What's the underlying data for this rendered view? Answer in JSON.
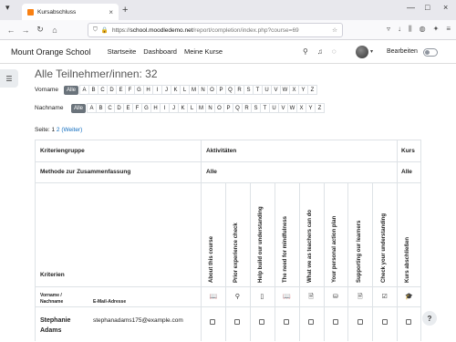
{
  "browser": {
    "tab_title": "Kursabschluss",
    "url_protocol": "https://",
    "url_host": "school.moodledemo.net",
    "url_rest": "/report/completion/index.php?course=69"
  },
  "header": {
    "brand": "Mount Orange School",
    "nav": [
      "Startseite",
      "Dashboard",
      "Meine Kurse"
    ],
    "edit_label": "Bearbeiten"
  },
  "page": {
    "title": "Alle Teilnehmer/innen: 32",
    "firstname_label": "Vorname",
    "lastname_label": "Nachname",
    "all_label": "Alle",
    "letters": [
      "A",
      "B",
      "C",
      "D",
      "E",
      "F",
      "G",
      "H",
      "I",
      "J",
      "K",
      "L",
      "M",
      "N",
      "O",
      "P",
      "Q",
      "R",
      "S",
      "T",
      "U",
      "V",
      "W",
      "X",
      "Y",
      "Z"
    ],
    "pager_label": "Seite:",
    "pager_current": "1",
    "pager_next_num": "2",
    "pager_next": "(Weiter)"
  },
  "table": {
    "row_criteria_group": "Kriteriengruppe",
    "activities_header": "Aktivitäten",
    "course_header": "Kurs",
    "row_method": "Methode zur Zusammenfassung",
    "activities_method": "Alle",
    "course_method": "Alle",
    "criteria_label": "Kriterien",
    "firstname_sub": "Vorname /",
    "lastname_sub": "Nachname",
    "email_sub": "E-Mail-Adresse",
    "activities": [
      {
        "name": "About this course",
        "icon": "book-icon",
        "glyph": "📖"
      },
      {
        "name": "Prior experience check",
        "icon": "choice-icon",
        "glyph": "⚲"
      },
      {
        "name": "Help build our understanding",
        "icon": "glossary-icon",
        "glyph": "▯"
      },
      {
        "name": "The need for mindfulness",
        "icon": "book-icon",
        "glyph": "📖"
      },
      {
        "name": "What we as teachers can do",
        "icon": "page-icon",
        "glyph": "🗎"
      },
      {
        "name": "Your personal action plan",
        "icon": "database-icon",
        "glyph": "⛁"
      },
      {
        "name": "Supporting our learners",
        "icon": "page-icon",
        "glyph": "🗎"
      },
      {
        "name": "Check your understanding",
        "icon": "quiz-icon",
        "glyph": "☑"
      }
    ],
    "course_completion_label": "Kurs abschließen",
    "course_completion_icon": "graduation-cap-icon",
    "course_completion_glyph": "🎓",
    "rows": [
      {
        "firstname": "Stephanie",
        "lastname": "Adams",
        "email": "stephanadams175@example.com"
      }
    ]
  },
  "help_glyph": "?"
}
